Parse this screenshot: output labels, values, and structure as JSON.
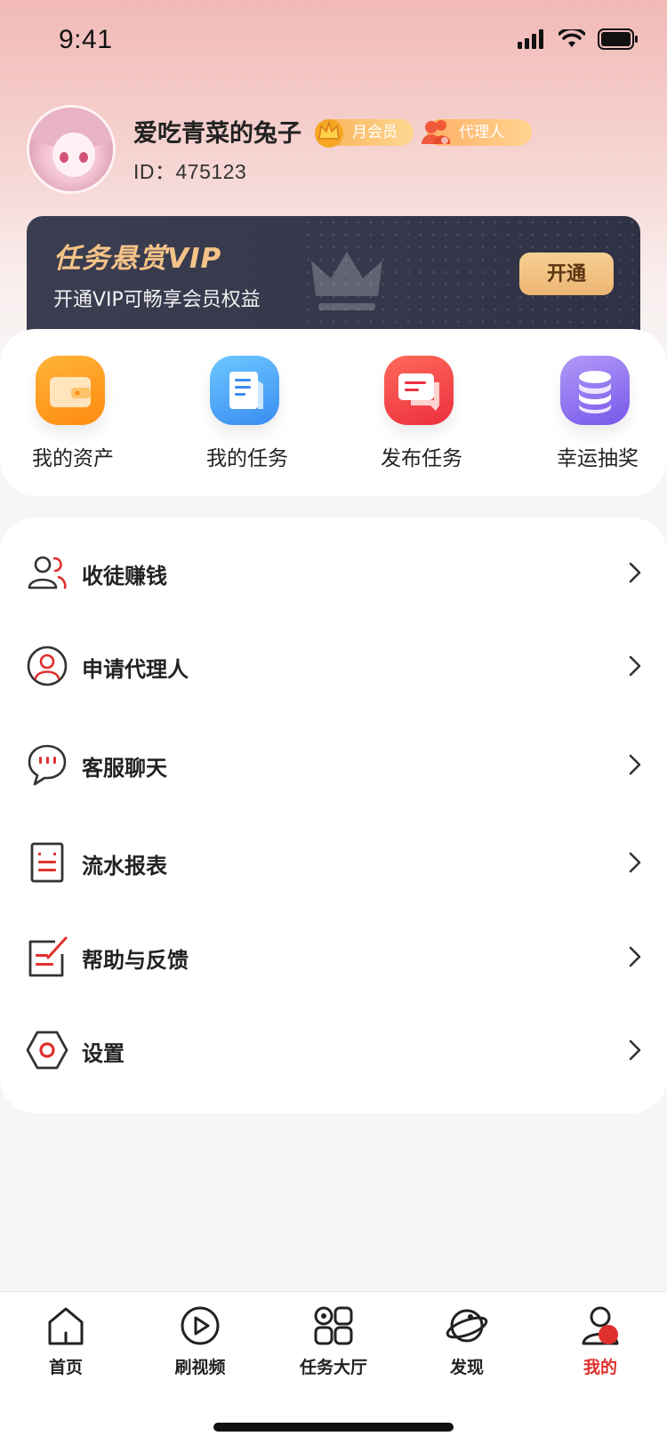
{
  "status_bar": {
    "time": "9:41"
  },
  "profile": {
    "name": "爱吃青菜的兔子",
    "badges": [
      "月会员",
      "代理人"
    ],
    "id_text": "ID：475123"
  },
  "vip": {
    "title": "任务悬赏VIP",
    "subtitle": "开通VIP可畅享会员权益",
    "button_label": "开通"
  },
  "quick_actions": [
    {
      "label": "我的资产",
      "icon": "wallet-icon",
      "color": "#ff9a1f"
    },
    {
      "label": "我的任务",
      "icon": "document-icon",
      "color": "#3fa5f5"
    },
    {
      "label": "发布任务",
      "icon": "message-icon",
      "color": "#f04a4a"
    },
    {
      "label": "幸运抽奖",
      "icon": "coins-icon",
      "color": "#8a6cf0"
    }
  ],
  "menu": [
    {
      "label": "收徒赚钱",
      "icon": "users-icon"
    },
    {
      "label": "申请代理人",
      "icon": "user-circle-icon"
    },
    {
      "label": "客服聊天",
      "icon": "chat-bubble-icon"
    },
    {
      "label": "流水报表",
      "icon": "report-icon"
    },
    {
      "label": "帮助与反馈",
      "icon": "edit-note-icon"
    },
    {
      "label": "设置",
      "icon": "settings-hexagon-icon"
    }
  ],
  "tabbar": [
    {
      "label": "首页",
      "icon": "home-icon",
      "active": false
    },
    {
      "label": "刷视频",
      "icon": "play-circle-icon",
      "active": false
    },
    {
      "label": "任务大厅",
      "icon": "grid-icon",
      "active": false
    },
    {
      "label": "发现",
      "icon": "planet-icon",
      "active": false
    },
    {
      "label": "我的",
      "icon": "profile-icon",
      "active": true
    }
  ],
  "colors": {
    "accent": "#e0302d",
    "vip_gold": "#f4c387",
    "vip_dark": "#383a4e"
  }
}
